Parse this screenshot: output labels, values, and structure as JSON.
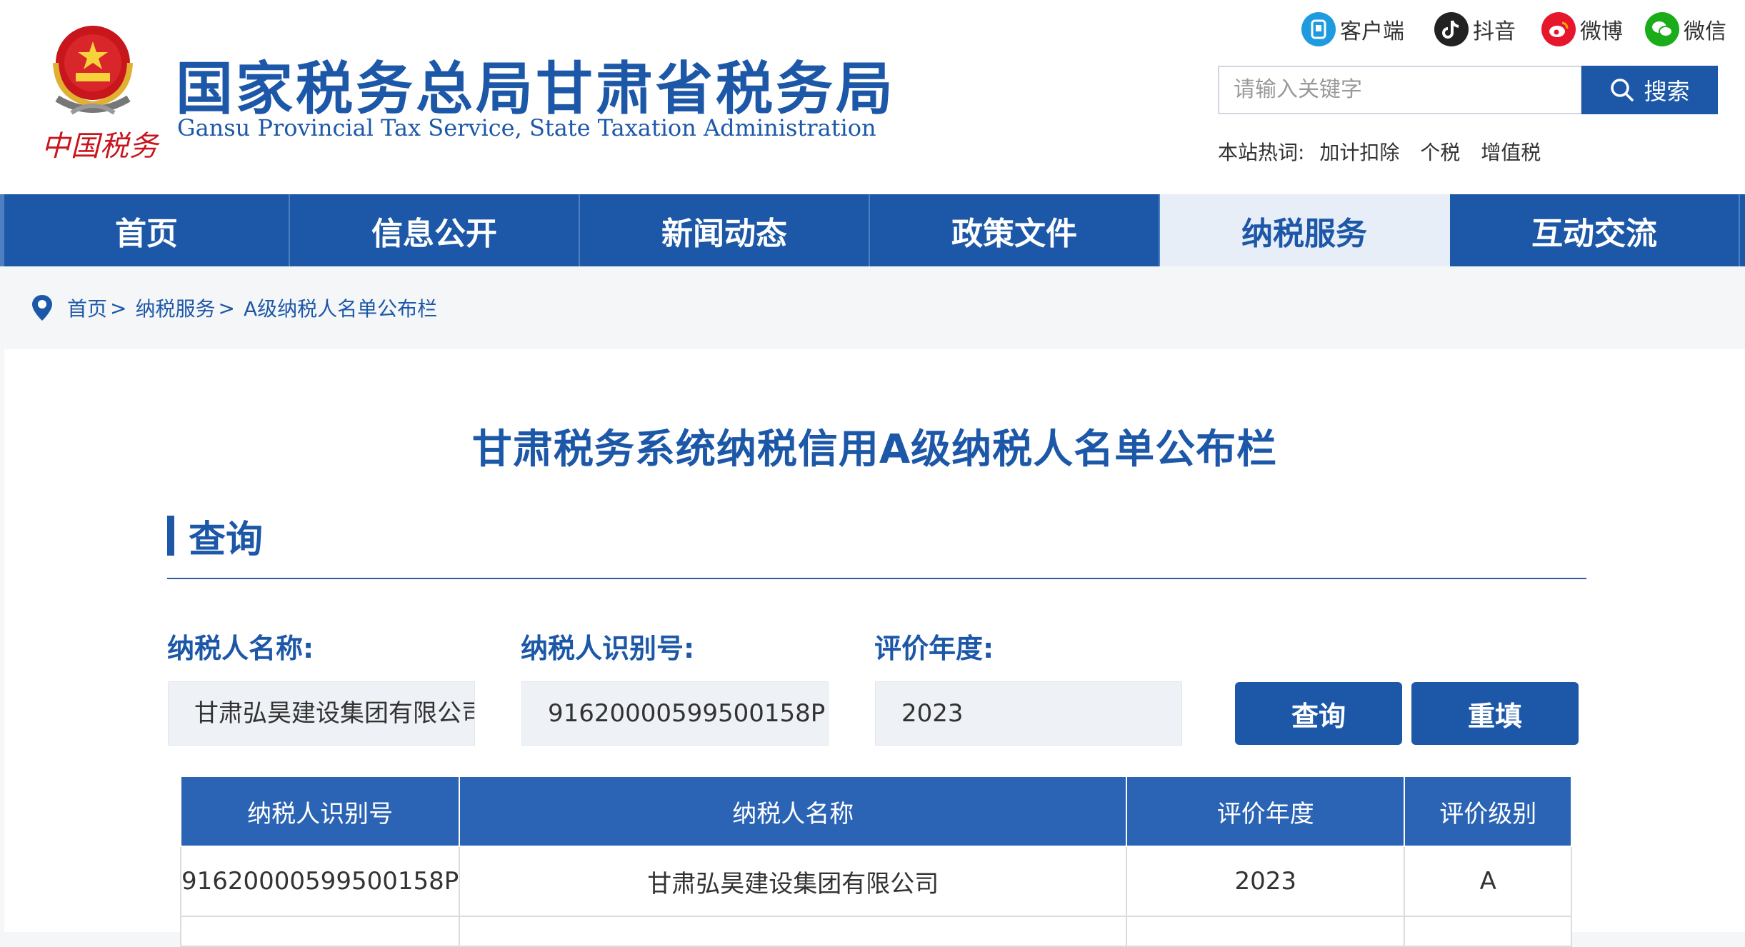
{
  "header": {
    "title": "国家税务总局甘肃省税务局",
    "subtitle": "Gansu Provincial Tax Service, State Taxation Administration",
    "logo_script": "中国税务",
    "social": [
      {
        "label": "客户端",
        "icon": "client-app-icon",
        "color": "#1e9be0"
      },
      {
        "label": "抖音",
        "icon": "douyin-icon",
        "color": "#222222"
      },
      {
        "label": "微博",
        "icon": "weibo-icon",
        "color": "#e6162d"
      },
      {
        "label": "微信",
        "icon": "wechat-icon",
        "color": "#1aad19"
      }
    ],
    "search": {
      "placeholder": "请输入关键字",
      "button_label": "搜索"
    },
    "hotwords": {
      "label": "本站热词:",
      "words": [
        "加计扣除",
        "个税",
        "增值税"
      ]
    }
  },
  "nav": {
    "items": [
      "首页",
      "信息公开",
      "新闻动态",
      "政策文件",
      "纳税服务",
      "互动交流"
    ],
    "active": "纳税服务"
  },
  "breadcrumb": {
    "items": [
      "首页",
      "纳税服务",
      "A级纳税人名单公布栏"
    ]
  },
  "main": {
    "title": "甘肃税务系统纳税信用A级纳税人名单公布栏",
    "section_title": "查询",
    "form": {
      "name_label": "纳税人名称:",
      "name_value": "甘肃弘昊建设集团有限公司",
      "id_label": "纳税人识别号:",
      "id_value": "91620000599500158P",
      "year_label": "评价年度:",
      "year_value": "2023",
      "query_button": "查询",
      "reset_button": "重填"
    },
    "table": {
      "headers": [
        "纳税人识别号",
        "纳税人名称",
        "评价年度",
        "评价级别"
      ],
      "rows": [
        [
          "91620000599500158P",
          "甘肃弘昊建设集团有限公司",
          "2023",
          "A"
        ]
      ]
    }
  },
  "colors": {
    "brand": "#1d58a8",
    "nav_active_bg": "#e8eef7",
    "table_header": "#2b64b5",
    "input_bg": "#eef2f6"
  }
}
